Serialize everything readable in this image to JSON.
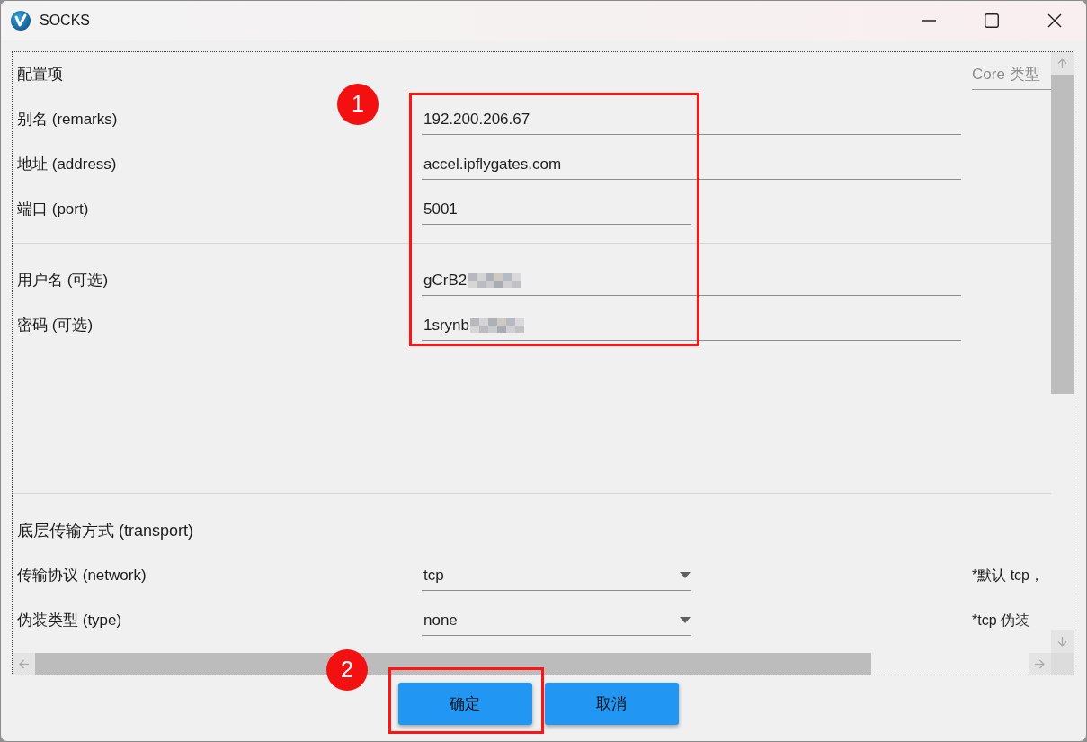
{
  "window": {
    "title": "SOCKS"
  },
  "sections": [
    {
      "heading": "配置项",
      "side_field": {
        "placeholder": "Core 类型"
      },
      "rows": [
        {
          "label": "别名 (remarks)",
          "kind": "text",
          "value": "192.200.206.67",
          "redacted": false
        },
        {
          "label": "地址 (address)",
          "kind": "text",
          "value": "accel.ipflygates.com",
          "redacted": false
        },
        {
          "label": "端口 (port)",
          "kind": "number",
          "value": "5001",
          "redacted": false
        }
      ]
    },
    {
      "rows": [
        {
          "label": "用户名 (可选)",
          "kind": "text",
          "value": "gCrB2",
          "redacted": true
        },
        {
          "label": "密码 (可选)",
          "kind": "text",
          "value": "1srynb",
          "redacted": true
        }
      ]
    },
    {
      "heading": "底层传输方式 (transport)",
      "rows": [
        {
          "label": "传输协议 (network)",
          "kind": "select",
          "value": "tcp",
          "redacted": false,
          "note": "*默认 tcp，"
        },
        {
          "label": "伪装类型 (type)",
          "kind": "select",
          "value": "none",
          "redacted": false,
          "note": "*tcp 伪装"
        }
      ]
    }
  ],
  "buttons": [
    {
      "label": "确定"
    },
    {
      "label": "取消"
    }
  ],
  "annotations": [
    {
      "number": "1"
    },
    {
      "number": "2"
    }
  ]
}
